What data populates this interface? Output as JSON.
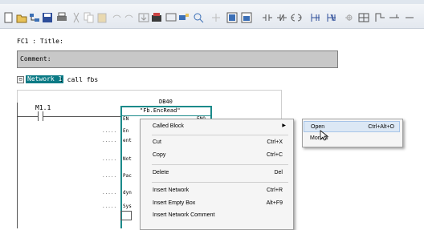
{
  "toolbar": {
    "buttons": [
      "new-icon",
      "open-icon",
      "accessible-nodes-icon",
      "save-icon",
      "print-icon",
      "cut-icon",
      "copy-icon",
      "paste-icon",
      "undo-icon",
      "redo-icon",
      "download-icon",
      "upload-icon",
      "monitor-icon",
      "overview-icon",
      "zoom-icon",
      "network-icon",
      "box-icon",
      "insert-network-icon",
      "contact-no-icon",
      "contact-nc-icon",
      "coil-icon",
      "branch-open-icon",
      "branch-close-icon"
    ]
  },
  "editor": {
    "fc_title": "FC1 : Title:",
    "comment_label": "Comment:",
    "expander": "⊟",
    "network_label": "Network 1",
    "network_title": ": call fbs",
    "contact_address": "M1.1",
    "db_name": "DB40",
    "fb_name": "\"Fb.EncRead\"",
    "pin_en": "EN",
    "pin_eno": "ENO",
    "pins": [
      "En",
      "ent",
      "Not",
      "Pac",
      "dyn",
      "Sys"
    ],
    "pin_dots": "....."
  },
  "context_menu": {
    "items": [
      {
        "label": "Called Block",
        "shortcut": "",
        "submenu": true
      },
      {
        "label": "Cut",
        "shortcut": "Ctrl+X"
      },
      {
        "label": "Copy",
        "shortcut": "Ctrl+C"
      },
      {
        "label": "Delete",
        "shortcut": "Del"
      },
      {
        "label": "Insert Network",
        "shortcut": "Ctrl+R"
      },
      {
        "label": "Insert Empty Box",
        "shortcut": "Alt+F9"
      },
      {
        "label": "Insert Network Comment",
        "shortcut": ""
      }
    ],
    "arrow": "▶"
  },
  "sub_menu": {
    "items": [
      {
        "label": "Open",
        "shortcut": "Ctrl+Alt+O"
      },
      {
        "label": "Monitor",
        "shortcut": ""
      }
    ]
  },
  "colors": {
    "network_badge": "#0b7a85",
    "fb_border": "#1b8a8a",
    "menu_highlight": "#dce8f5"
  }
}
